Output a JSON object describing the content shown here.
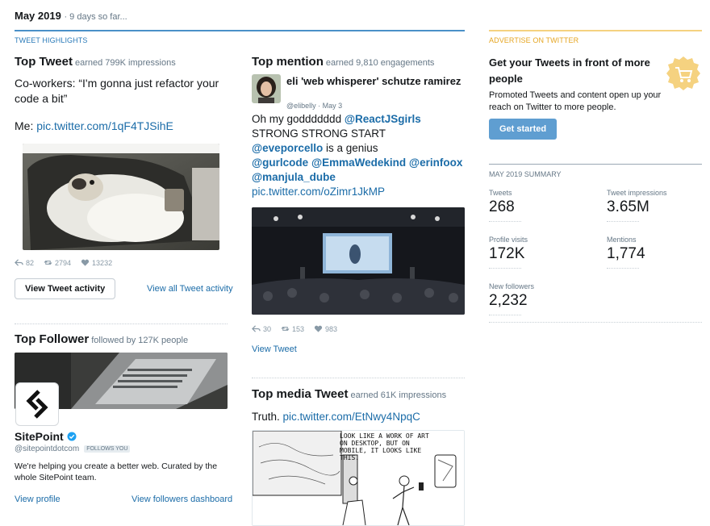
{
  "header": {
    "month": "May 2019",
    "sub": "· 9 days so far..."
  },
  "highlights": {
    "label": "TWEET HIGHLIGHTS"
  },
  "top_tweet": {
    "title": "Top Tweet",
    "meta": "earned 799K impressions",
    "text_line": "Co-workers: “I'm gonna just refactor your code a bit”",
    "me_label": "Me:",
    "link": "pic.twitter.com/1qF4TJSihE",
    "replies": "82",
    "retweets": "2794",
    "likes": "13232",
    "activity_button": "View Tweet activity",
    "all_activity_link": "View all Tweet activity"
  },
  "top_follower": {
    "title": "Top Follower",
    "meta": "followed by 127K people",
    "name": "SitePoint",
    "handle": "@sitepointdotcom",
    "follows_badge": "FOLLOWS YOU",
    "bio": "We're helping you create a better web. Curated by the whole SitePoint team.",
    "view_profile": "View profile",
    "dashboard_link": "View followers dashboard"
  },
  "top_mention": {
    "title": "Top mention",
    "meta": "earned 9,810 engagements",
    "author_name": "eli 'web whisperer' schutze ramirez",
    "author_handle": "@elibelly",
    "date": "· May 3",
    "line1_text": "Oh my goddddddd",
    "line1_link": "@ReactJSgirls",
    "line2": "STRONG STRONG START",
    "line3_link": "@eveporcello",
    "line3_text": "is a genius",
    "line4_links": [
      "@gurlcode",
      "@EmmaWedekind",
      "@erinfoox"
    ],
    "line5_link": "@manjula_dube",
    "pic_link": "pic.twitter.com/oZimr1JkMP",
    "replies": "30",
    "retweets": "153",
    "likes": "983",
    "view_tweet": "View Tweet"
  },
  "top_media": {
    "title": "Top media Tweet",
    "meta": "earned 61K impressions",
    "text": "Truth.",
    "link": "pic.twitter.com/EtNwy4NpqC",
    "comic_text": "LOOK LIKE A WORK OF ART ON DESKTOP, BUT ON MOBILE, IT LOOKS LIKE THIS."
  },
  "ad": {
    "label": "ADVERTISE ON TWITTER",
    "title": "Get your Tweets in front of more people",
    "desc": "Promoted Tweets and content open up your reach on Twitter to more people.",
    "button": "Get started",
    "accent": "#f5d280"
  },
  "summary": {
    "label": "MAY 2019 SUMMARY",
    "tweets_label": "Tweets",
    "tweets": "268",
    "impressions_label": "Tweet impressions",
    "impressions": "3.65M",
    "visits_label": "Profile visits",
    "visits": "172K",
    "mentions_label": "Mentions",
    "mentions": "1,774",
    "followers_label": "New followers",
    "followers": "2,232"
  },
  "colors": {
    "link": "#1b6ca8",
    "button": "#5f9ed1",
    "highlight_rule": "#4a90c8"
  }
}
